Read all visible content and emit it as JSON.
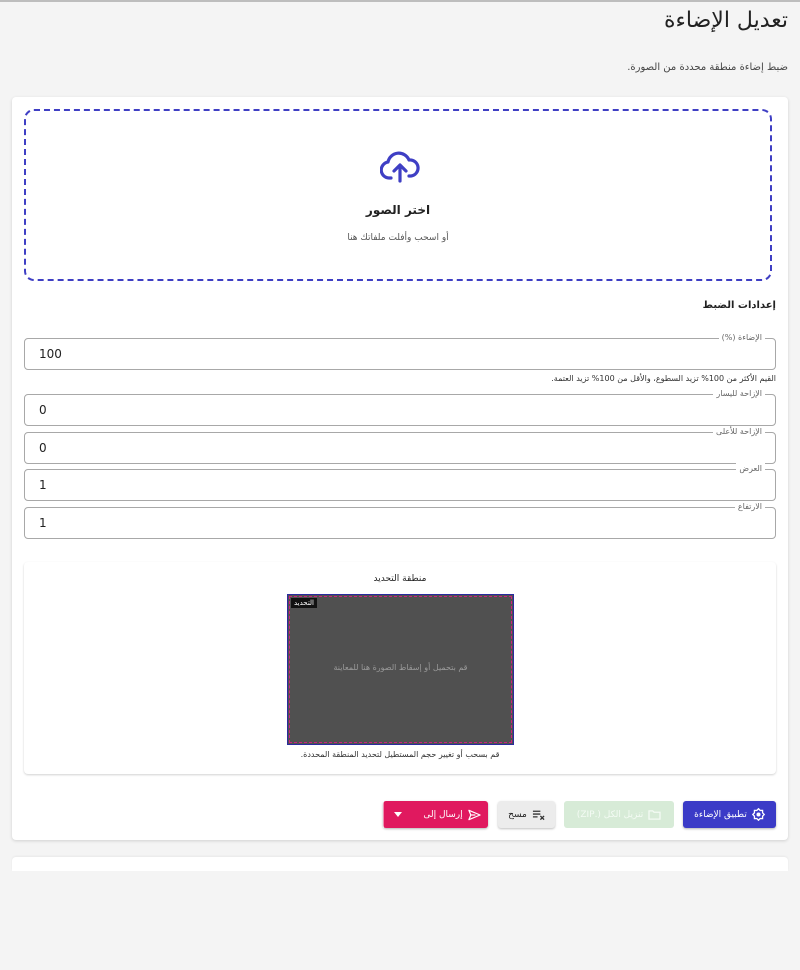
{
  "page": {
    "title": "تعديل الإضاءة",
    "description": "ضبط إضاءة منطقة محددة من الصورة."
  },
  "dropzone": {
    "icon": "cloud-upload-icon",
    "title": "اختر الصور",
    "subtitle": "أو اسحب وأفلت ملفاتك هنا"
  },
  "settings": {
    "title": "إعدادات الضبط",
    "fields": [
      {
        "label": "الإضاءة (%)",
        "value": "100"
      },
      {
        "label": "الإزاحة لليسار",
        "value": "0"
      },
      {
        "label": "الإزاحة للأعلى",
        "value": "0"
      },
      {
        "label": "العرض",
        "value": "1"
      },
      {
        "label": "الارتفاع",
        "value": "1"
      }
    ],
    "helper": "القيم الأكثر من 100% تزيد السطوع، والأقل من 100% تزيد العتمة."
  },
  "selection": {
    "title": "منطقة التحديد",
    "tag": "التحديد",
    "placeholder": "قم بتحميل أو إسقاط الصورة هنا للمعاينة",
    "note": "قم بسحب أو تغيير حجم المستطيل لتحديد المنطقة المحددة."
  },
  "actions": {
    "apply_label": "تطبيق الإضاءة",
    "zip_label": "تنزيل الكل (.ZIP)",
    "clear_label": "مسح",
    "send_label": "إرسال إلى"
  },
  "colors": {
    "accent": "#3b3bc7",
    "send": "#e0195f",
    "zip_disabled": "#d7ebd7"
  }
}
